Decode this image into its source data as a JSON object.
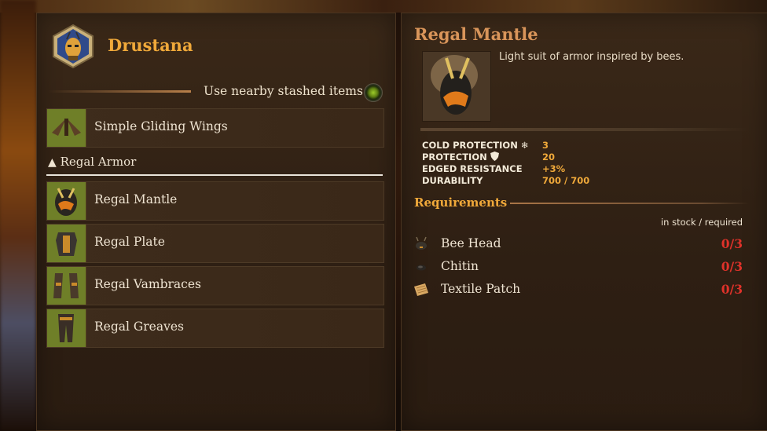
{
  "character": {
    "name": "Drustana"
  },
  "stash": {
    "label": "Use nearby stashed items"
  },
  "crafting_list": {
    "top_item": "Simple Gliding Wings",
    "category": "Regal Armor",
    "items": [
      "Regal Mantle",
      "Regal Plate",
      "Regal Vambraces",
      "Regal Greaves"
    ]
  },
  "detail": {
    "title": "Regal Mantle",
    "description": "Light suit of armor inspired by bees.",
    "stats": [
      {
        "name": "COLD PROTECTION",
        "icon": "snowflake-icon",
        "value": "3"
      },
      {
        "name": "PROTECTION",
        "icon": "shield-icon",
        "value": "20"
      },
      {
        "name": "EDGED RESISTANCE",
        "value": "+3%"
      },
      {
        "name": "DURABILITY",
        "value": "700 / 700"
      }
    ],
    "requirements_title": "Requirements",
    "requirements_legend": "in stock / required",
    "requirements": [
      {
        "name": "Bee Head",
        "count": "0/3",
        "icon": "bee-head-icon"
      },
      {
        "name": "Chitin",
        "count": "0/3",
        "icon": "chitin-icon"
      },
      {
        "name": "Textile Patch",
        "count": "0/3",
        "icon": "textile-patch-icon"
      }
    ]
  },
  "colors": {
    "accent": "#f0a93a",
    "missing": "#e0322a",
    "thumb_bg": "#6f7f28"
  }
}
